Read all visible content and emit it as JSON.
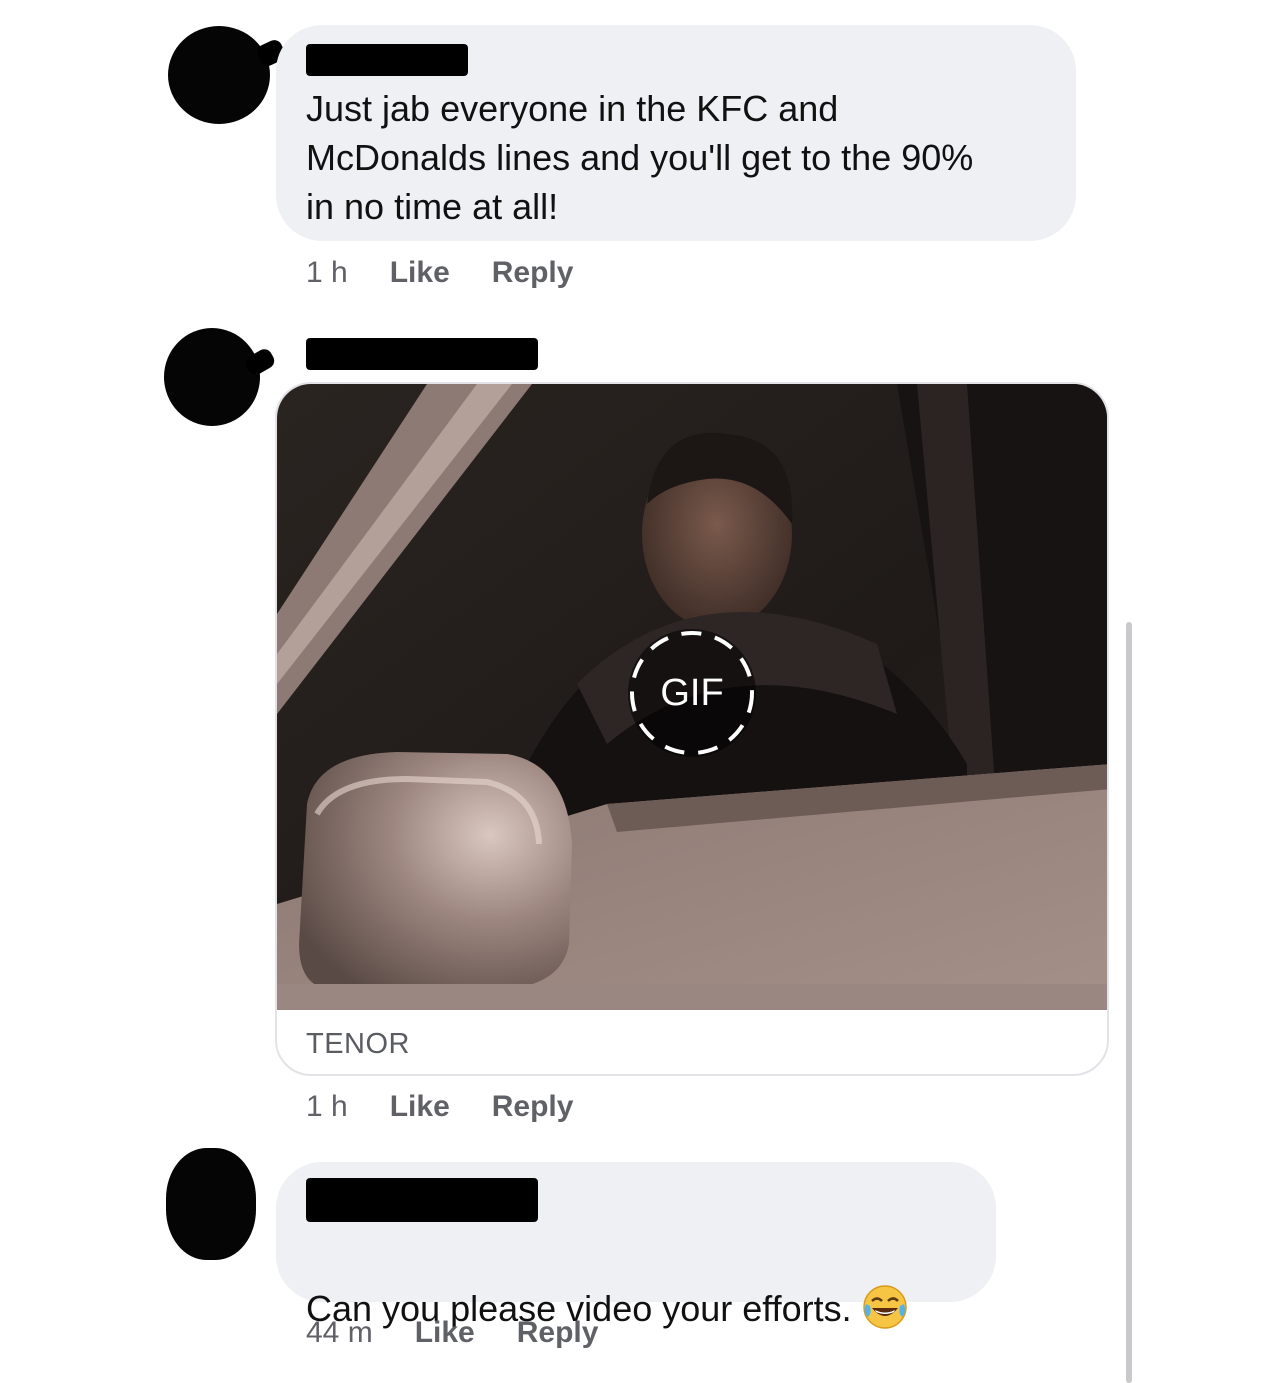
{
  "comments": [
    {
      "text": "Just jab everyone in the KFC and\nMcDonalds lines and you'll get to the 90%\nin no time at all!",
      "time": "1 h",
      "like": "Like",
      "reply": "Reply"
    },
    {
      "gif_badge": "GIF",
      "gif_source": "TENOR",
      "time": "1 h",
      "like": "Like",
      "reply": "Reply"
    },
    {
      "text": "Can you please video your efforts.",
      "emoji": "face-with-tears-of-joy-icon",
      "time": "44 m",
      "like": "Like",
      "reply": "Reply"
    }
  ],
  "colors": {
    "bubble": "#eff0f4",
    "text": "#111111",
    "meta": "#5f6167"
  }
}
